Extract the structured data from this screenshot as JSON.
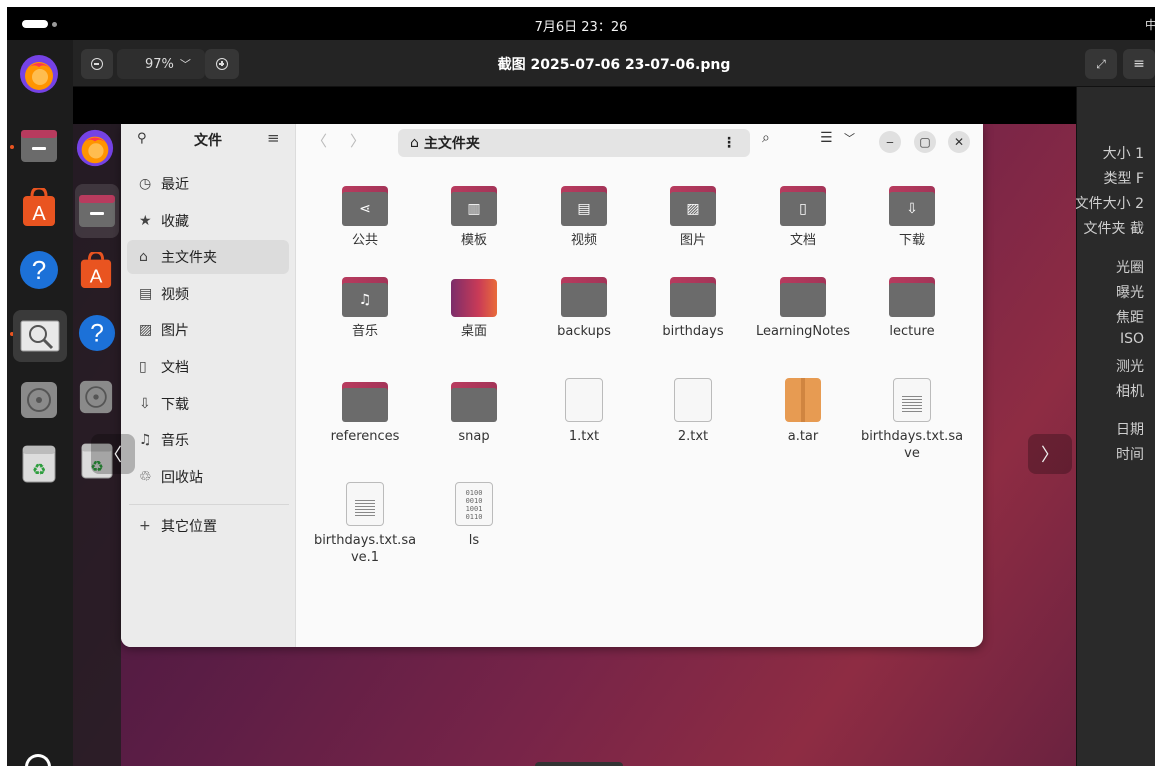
{
  "topbar": {
    "clock": "7月6日 23：26",
    "tray_glyph": "中"
  },
  "viewer": {
    "zoom": "97%",
    "title": "截图 2025-07-06 23-07-06.png",
    "properties": [
      "大小 1",
      "类型 F",
      "文件大小 2",
      "文件夹 截",
      "光圈",
      "曝光",
      "焦距",
      "ISO",
      "测光",
      "相机",
      "日期",
      "时间"
    ]
  },
  "files_app": {
    "sidebar_title": "文件",
    "location": "主文件夹",
    "sidebar": [
      {
        "icon": "clock-icon",
        "label": "最近"
      },
      {
        "icon": "star-icon",
        "label": "收藏"
      },
      {
        "icon": "home-icon",
        "label": "主文件夹"
      },
      {
        "icon": "video-icon",
        "label": "视频"
      },
      {
        "icon": "image-icon",
        "label": "图片"
      },
      {
        "icon": "document-icon",
        "label": "文档"
      },
      {
        "icon": "download-icon",
        "label": "下载"
      },
      {
        "icon": "music-icon",
        "label": "音乐"
      },
      {
        "icon": "trash-icon",
        "label": "回收站"
      }
    ],
    "other_locations": "其它位置",
    "items": [
      {
        "label": "公共",
        "kind": "folder",
        "glyph": "share-icon"
      },
      {
        "label": "模板",
        "kind": "folder",
        "glyph": "template-icon"
      },
      {
        "label": "视频",
        "kind": "folder",
        "glyph": "video-icon"
      },
      {
        "label": "图片",
        "kind": "folder",
        "glyph": "image-icon"
      },
      {
        "label": "文档",
        "kind": "folder",
        "glyph": "document-icon"
      },
      {
        "label": "下载",
        "kind": "folder",
        "glyph": "download-icon"
      },
      {
        "label": "音乐",
        "kind": "folder",
        "glyph": "music-icon"
      },
      {
        "label": "桌面",
        "kind": "desktop-folder",
        "glyph": "desktop-icon"
      },
      {
        "label": "backups",
        "kind": "folder",
        "glyph": ""
      },
      {
        "label": "birthdays",
        "kind": "folder",
        "glyph": ""
      },
      {
        "label": "LearningNotes",
        "kind": "folder",
        "glyph": ""
      },
      {
        "label": "lecture",
        "kind": "folder",
        "glyph": ""
      },
      {
        "label": "references",
        "kind": "folder",
        "glyph": ""
      },
      {
        "label": "snap",
        "kind": "folder",
        "glyph": ""
      },
      {
        "label": "1.txt",
        "kind": "blank-file",
        "glyph": ""
      },
      {
        "label": "2.txt",
        "kind": "blank-file",
        "glyph": ""
      },
      {
        "label": "a.tar",
        "kind": "archive",
        "glyph": "archive-icon"
      },
      {
        "label": "birthdays.txt.save",
        "kind": "text-file",
        "glyph": ""
      },
      {
        "label": "birthdays.txt.save.1",
        "kind": "text-file",
        "glyph": ""
      },
      {
        "label": "ls",
        "kind": "binary-file",
        "glyph": "binary-icon"
      }
    ],
    "binary_glyph_text": "0100\n0010\n1001\n0110"
  },
  "dock_apps": [
    "firefox-icon",
    "files-icon",
    "app-center-icon",
    "help-icon",
    "image-viewer-icon",
    "disc-icon",
    "recycle-bin-icon"
  ]
}
